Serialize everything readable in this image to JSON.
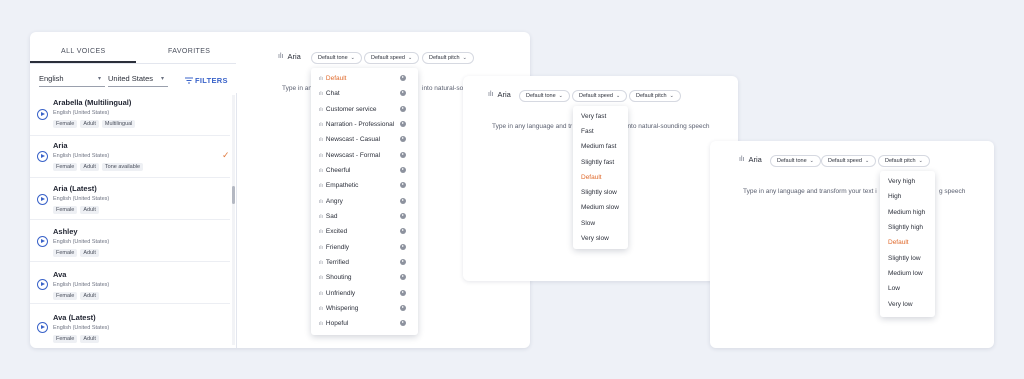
{
  "sidebar": {
    "tabs": [
      "ALL VOICES",
      "FAVORITES"
    ],
    "language": "English",
    "region": "United States",
    "filters_label": "FILTERS",
    "voices": [
      {
        "name": "Arabella (Multilingual)",
        "lang": "English (United States)",
        "tags": [
          "Female",
          "Adult",
          "Multilingual"
        ],
        "selected": false
      },
      {
        "name": "Aria",
        "lang": "English (United States)",
        "tags": [
          "Female",
          "Adult",
          "Tone available"
        ],
        "selected": true
      },
      {
        "name": "Aria (Latest)",
        "lang": "English (United States)",
        "tags": [
          "Female",
          "Adult"
        ],
        "selected": false
      },
      {
        "name": "Ashley",
        "lang": "English (United States)",
        "tags": [
          "Female",
          "Adult"
        ],
        "selected": false
      },
      {
        "name": "Ava",
        "lang": "English (United States)",
        "tags": [
          "Female",
          "Adult"
        ],
        "selected": false
      },
      {
        "name": "Ava (Latest)",
        "lang": "English (United States)",
        "tags": [
          "Female",
          "Adult"
        ],
        "selected": false
      }
    ]
  },
  "panel1": {
    "speaker": "Aria",
    "tone": "Default tone",
    "speed": "Default speed",
    "pitch": "Default pitch",
    "hint_left": "Type in an",
    "hint_right": "into natural-so",
    "tone_menu": [
      "Default",
      "Chat",
      "Customer service",
      "Narration - Professional",
      "Newscast - Casual",
      "Newscast - Formal",
      "Cheerful",
      "Empathetic",
      "Angry",
      "Sad",
      "Excited",
      "Friendly",
      "Terrified",
      "Shouting",
      "Unfriendly",
      "Whispering",
      "Hopeful"
    ],
    "tone_active": "Default"
  },
  "panel2": {
    "speaker": "Aria",
    "tone": "Default tone",
    "speed": "Default speed",
    "pitch": "Default pitch",
    "hint_left": "Type in any language and tr",
    "hint_right": "into natural-sounding speech",
    "speed_menu": [
      "Very fast",
      "Fast",
      "Medium fast",
      "Slightly fast",
      "Default",
      "Slightly slow",
      "Medium slow",
      "Slow",
      "Very slow"
    ],
    "speed_active": "Default"
  },
  "panel3": {
    "speaker": "Aria",
    "tone": "Default tone",
    "speed": "Default speed",
    "pitch": "Default pitch",
    "hint_left": "Type in any language and transform your text i",
    "hint_right": "g speech",
    "pitch_menu": [
      "Very high",
      "High",
      "Medium high",
      "Slightly high",
      "Default",
      "Slightly low",
      "Medium low",
      "Low",
      "Very low"
    ],
    "pitch_active": "Default"
  },
  "colors": {
    "accent": "#3a63c9",
    "active_option": "#e06a2c",
    "checkmark": "#e07a3f",
    "background": "#eef1f7"
  }
}
